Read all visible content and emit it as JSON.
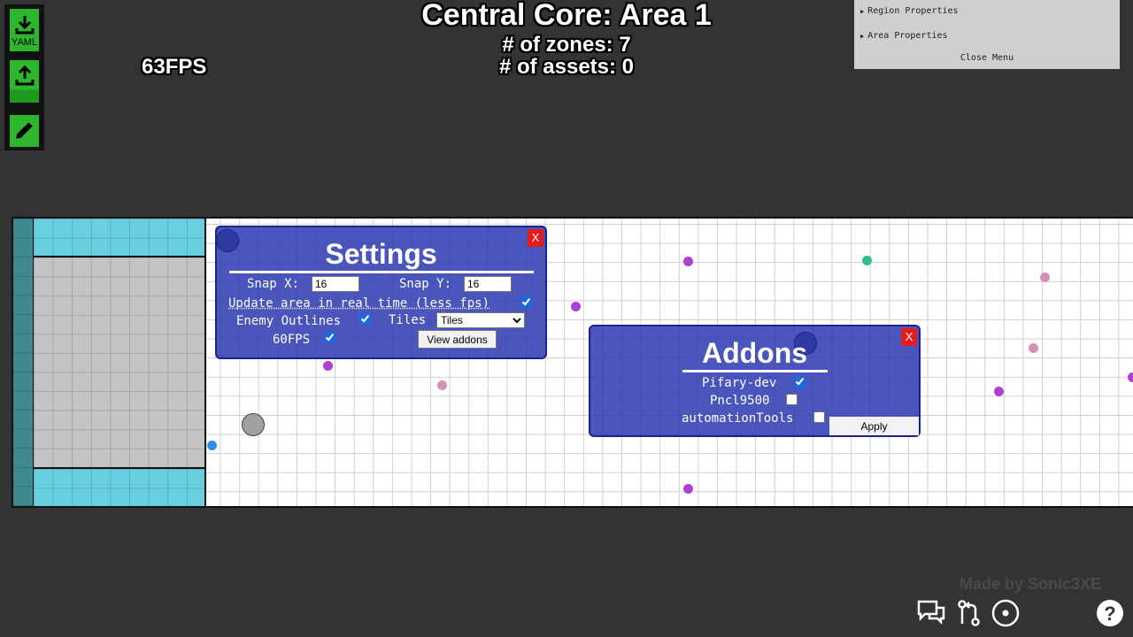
{
  "toolbar": {
    "download_label": "YAML",
    "icons": [
      "download-icon",
      "upload-icon",
      "pencil-icon"
    ],
    "button_color": "#2db52d"
  },
  "hud": {
    "fps": "63FPS",
    "area_title": "Central Core: Area 1",
    "zones": "# of zones: 7",
    "assets": "# of assets: 0"
  },
  "props_menu": {
    "region": "Region Properties",
    "area": "Area Properties",
    "close": "Close Menu"
  },
  "settings": {
    "title": "Settings",
    "close": "X",
    "snap_x_label": "Snap X:",
    "snap_x_value": "16",
    "snap_y_label": "Snap Y:",
    "snap_y_value": "16",
    "realtime_label": "Update area in real time (less fps)",
    "realtime_checked": true,
    "outlines_label": "Enemy Outlines",
    "outlines_checked": true,
    "tiles_label": "Tiles",
    "tiles_selected": "Tiles",
    "fps60_label": "60FPS",
    "fps60_checked": true,
    "view_addons": "View addons"
  },
  "addons": {
    "title": "Addons",
    "close": "X",
    "items": [
      {
        "label": "Pifary-dev",
        "checked": true
      },
      {
        "label": "Pncl9500",
        "checked": false
      },
      {
        "label": "automationTools",
        "checked": false
      }
    ],
    "apply": "Apply"
  },
  "map": {
    "colors": {
      "teal": "#3d8a91",
      "cyan": "#68cfe0",
      "safe_zone": "#c4c4c4",
      "enemy_purple": "#b03fd6",
      "enemy_pink": "#d68fb8",
      "enemy_green": "#2fbf8f",
      "enemy_blue": "#2f8fe8"
    }
  },
  "footer": {
    "credit": "Made by Sonic3XE",
    "icons": [
      "chat-icon",
      "git-compare-icon",
      "record-icon",
      "help-icon"
    ]
  }
}
